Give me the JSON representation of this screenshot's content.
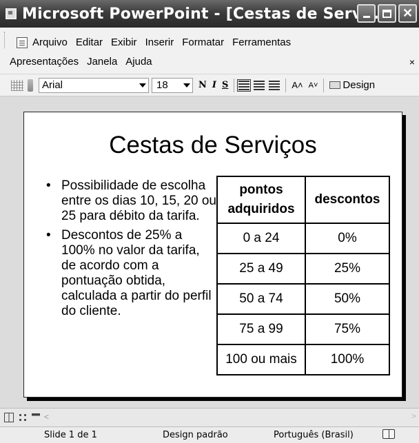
{
  "window": {
    "title": "Microsoft PowerPoint - [Cestas de Servi..."
  },
  "menu": {
    "row1": [
      "Arquivo",
      "Editar",
      "Exibir",
      "Inserir",
      "Formatar",
      "Ferramentas"
    ],
    "row2": [
      "Apresentações",
      "Janela",
      "Ajuda"
    ],
    "close_label": "×"
  },
  "toolbar": {
    "font": "Arial",
    "size": "18",
    "bold": "N",
    "italic": "I",
    "underline": "S",
    "grow": "A˄",
    "shrink": "A˅",
    "design_label": "Design"
  },
  "slide": {
    "title": "Cestas de Serviços",
    "bullets": [
      "Possibilidade de escolha entre os dias 10, 15, 20 ou 25 para débito da tarifa.",
      "Descontos de 25% a 100% no valor da tarifa, de acordo com a pontuação obtida, calculada a partir do perfil do cliente."
    ],
    "table": {
      "headers": [
        "pontos adquiridos",
        "descontos"
      ],
      "rows": [
        [
          "0 a 24",
          "0%"
        ],
        [
          "25 a 49",
          "25%"
        ],
        [
          "50 a 74",
          "50%"
        ],
        [
          "75 a 99",
          "75%"
        ],
        [
          "100 ou mais",
          "100%"
        ]
      ]
    }
  },
  "status": {
    "slide": "Slide 1 de 1",
    "design": "Design padrão",
    "language": "Português (Brasil)"
  },
  "colors": {
    "titlebar": "#3c3c3c",
    "workspace": "#dcdcdc"
  }
}
